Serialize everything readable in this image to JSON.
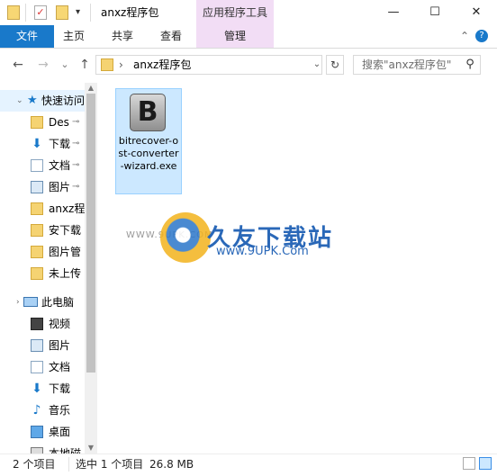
{
  "title_bar": {
    "window_title": "anxz程序包",
    "context_tab_label": "应用程序工具",
    "controls": {
      "minimize": "—",
      "maximize": "☐",
      "close": "✕"
    },
    "quick_access_dropdown": "▾"
  },
  "ribbon": {
    "file_tab": "文件",
    "tabs": [
      "主页",
      "共享",
      "查看",
      "管理"
    ],
    "collapse_icon": "⌃",
    "help_icon": "?",
    "accent_color": "#1979ca"
  },
  "nav": {
    "back": "←",
    "forward": "→",
    "recent": "⌄",
    "up": "↑",
    "breadcrumb_sep": "›",
    "breadcrumb": "anxz程序包",
    "address_dropdown": "⌄",
    "refresh": "↻",
    "search_placeholder": "搜索\"anxz程序包\"",
    "search_icon": "search-icon"
  },
  "sidebar": {
    "quick_access_label": "快速访问",
    "quick_items": [
      {
        "label": "Des",
        "icon": "folder-icon",
        "pinned": true
      },
      {
        "label": "下载",
        "icon": "download-icon",
        "pinned": true
      },
      {
        "label": "文档",
        "icon": "document-icon",
        "pinned": true
      },
      {
        "label": "图片",
        "icon": "picture-icon",
        "pinned": true
      },
      {
        "label": "anxz程",
        "icon": "folder-icon",
        "pinned": false
      },
      {
        "label": "安下载",
        "icon": "folder-icon",
        "pinned": false
      },
      {
        "label": "图片管",
        "icon": "folder-icon",
        "pinned": false
      },
      {
        "label": "未上传",
        "icon": "folder-icon",
        "pinned": false
      }
    ],
    "pc_label": "此电脑",
    "pc_items": [
      {
        "label": "视频",
        "icon": "video-icon"
      },
      {
        "label": "图片",
        "icon": "picture-icon"
      },
      {
        "label": "文档",
        "icon": "document-icon"
      },
      {
        "label": "下载",
        "icon": "download-icon"
      },
      {
        "label": "音乐",
        "icon": "music-icon"
      },
      {
        "label": "桌面",
        "icon": "desktop-icon"
      },
      {
        "label": "本地磁",
        "icon": "drive-icon"
      }
    ],
    "pin_glyph": "📌"
  },
  "content": {
    "file": {
      "name": "bitrecover-ost-converter-wizard.exe",
      "icon_letter": "B",
      "selected": true
    },
    "watermark": {
      "brand": "久友下载站",
      "url": "www.9UPK.Com",
      "url_faint": "WWW.9UPK.COM"
    }
  },
  "status_bar": {
    "item_count": "2 个项目",
    "selection": "选中 1 个项目",
    "size": "26.8 MB"
  }
}
